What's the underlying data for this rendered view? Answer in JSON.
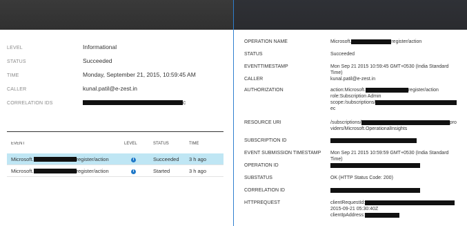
{
  "summary": {
    "level": {
      "label": "LEVEL",
      "value": "Informational"
    },
    "status": {
      "label": "STATUS",
      "value": "Succeeded"
    },
    "time": {
      "label": "TIME",
      "value": "Monday, September 21, 2015, 10:59:45 AM"
    },
    "caller": {
      "label": "CALLER",
      "value": "kunal.patil@e-zest.in"
    },
    "correlation": {
      "label": "CORRELATION IDS",
      "value_suffix": "c"
    }
  },
  "events": {
    "headers": {
      "event": "EVENT",
      "level": "LEVEL",
      "status": "STATUS",
      "time": "TIME"
    },
    "rows": [
      {
        "prefix": "Microsoft.",
        "suffix": "register/action",
        "status": "Succeeded",
        "time": "3 h ago",
        "selected": true
      },
      {
        "prefix": "Microsoft.",
        "suffix": "register/action",
        "status": "Started",
        "time": "3 h ago",
        "selected": false
      }
    ]
  },
  "details": {
    "operation_name": {
      "label": "OPERATION NAME",
      "prefix": "Microsoft.",
      "suffix": "register/action"
    },
    "status": {
      "label": "STATUS",
      "value": "Succeeded"
    },
    "eventtimestamp": {
      "label": "EVENTTIMESTAMP",
      "value": "Mon Sep 21 2015 10:59:45 GMT+0530 (India Standard Time)"
    },
    "caller": {
      "label": "CALLER",
      "value": "kunal.patil@e-zest.in"
    },
    "authorization": {
      "label": "AUTHORIZATION",
      "line1_prefix": "action:Microsoft.",
      "line1_suffix": "register/action",
      "line2": "role:Subscription Admin",
      "line3_prefix": "scope:/subscriptions/",
      "line4": "ec"
    },
    "resource_uri": {
      "label": "RESOURCE URI",
      "line1_prefix": "/subscriptions/",
      "line1_suffix": "pro",
      "line2": "viders/Microsoft.OperationalInsights"
    },
    "subscription_id": {
      "label": "SUBSCRIPTION ID"
    },
    "submission_timestamp": {
      "label": "EVENT SUBMISSION TIMESTAMP",
      "value": "Mon Sep 21 2015 10:59:59 GMT+0530 (India Standard Time)"
    },
    "operation_id": {
      "label": "OPERATION ID"
    },
    "substatus": {
      "label": "SUBSTATUS",
      "value": "OK (HTTP Status Code: 200)"
    },
    "correlation_id": {
      "label": "CORRELATION ID"
    },
    "httprequest": {
      "label": "HTTPREQUEST",
      "line1": "clientRequestId:",
      "line2": "2015-09-21 05:30:40Z",
      "line3": "clientIpAddress:"
    }
  },
  "icons": {
    "info": "info-icon"
  },
  "colors": {
    "selected_row": "#bfe6f4",
    "info_icon": "#1e78c8",
    "divider": "#2f7fcf"
  }
}
